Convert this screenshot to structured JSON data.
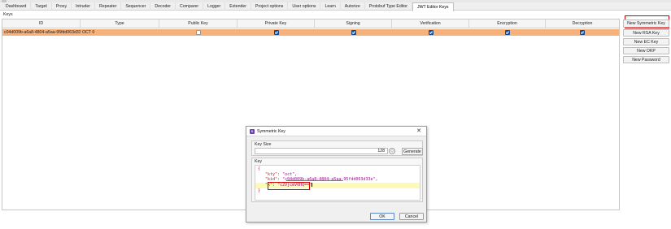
{
  "tabs": [
    {
      "label": "Dashboard"
    },
    {
      "label": "Target"
    },
    {
      "label": "Proxy"
    },
    {
      "label": "Intruder"
    },
    {
      "label": "Repeater"
    },
    {
      "label": "Sequencer"
    },
    {
      "label": "Decoder"
    },
    {
      "label": "Comparer"
    },
    {
      "label": "Logger"
    },
    {
      "label": "Extender"
    },
    {
      "label": "Project options"
    },
    {
      "label": "User options"
    },
    {
      "label": "Learn"
    },
    {
      "label": "Autorize"
    },
    {
      "label": "Protobuf Type Editor"
    },
    {
      "label": "JWT Editor Keys",
      "active": true
    }
  ],
  "section_label": "Keys",
  "table": {
    "columns": [
      "ID",
      "Type",
      "Public Key",
      "Private Key",
      "Signing",
      "Verification",
      "Encryption",
      "Decryption"
    ],
    "rows": [
      {
        "id": "c04d009b-a6a8-4804-a5aa-95fdd063d33e",
        "type": "OCT",
        "type_size": "0",
        "public_key": false,
        "private_key": true,
        "signing": true,
        "verification": true,
        "encryption": true,
        "decryption": true
      }
    ]
  },
  "side_buttons": {
    "new_symmetric": "New Symmetric Key",
    "new_rsa": "New RSA Key",
    "new_ec": "New EC Key",
    "new_okp": "New OKP",
    "new_password": "New Password"
  },
  "dialog": {
    "title": "Symmetric Key",
    "icon_letter": "B",
    "close_glyph": "✕",
    "key_size_label": "Key Size",
    "key_size_value": "128",
    "spinner_glyph": "◇",
    "generate_label": "Generate",
    "key_label": "Key",
    "code": {
      "open_brace": "{",
      "kty_key": "\"kty\"",
      "kty_value": "\"oct\"",
      "kid_key": "\"kid\"",
      "kid_value": "\"c04d009b-a6a8-4804-a5aa-95fdd063d33e\"",
      "k_key": "\"k\"",
      "k_value": "\"c2VjcmV0HQ==\"",
      "close_brace": "}"
    },
    "ok_label": "OK",
    "cancel_label": "Cancel"
  },
  "colors": {
    "row_selected": "#f7b17b",
    "checkbox_checked": "#1e5fb4",
    "highlight_red": "#d40000",
    "editor_line_highlight": "#fbfbb7"
  }
}
